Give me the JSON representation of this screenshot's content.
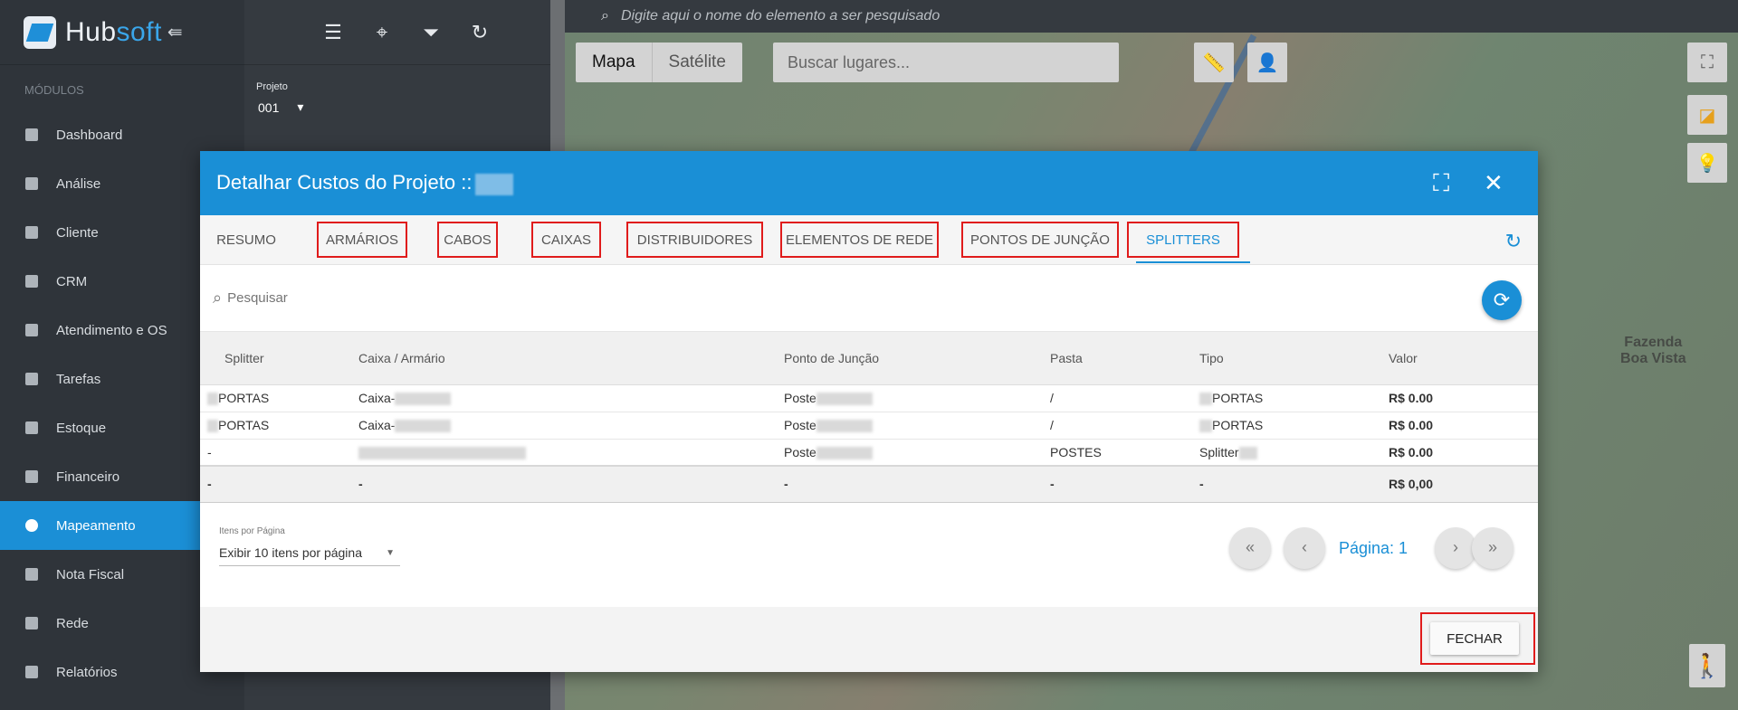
{
  "app": {
    "brand_part1": "Hub",
    "brand_part2": "soft",
    "modules_label": "MÓDULOS"
  },
  "sidebar": {
    "items": [
      {
        "label": "Dashboard",
        "icon": "dashboard-icon"
      },
      {
        "label": "Análise",
        "icon": "pie-chart-icon"
      },
      {
        "label": "Cliente",
        "icon": "contact-card-icon"
      },
      {
        "label": "CRM",
        "icon": "crm-icon"
      },
      {
        "label": "Atendimento e OS",
        "icon": "clock-icon"
      },
      {
        "label": "Tarefas",
        "icon": "calendar-icon"
      },
      {
        "label": "Estoque",
        "icon": "box-icon"
      },
      {
        "label": "Financeiro",
        "icon": "money-icon"
      },
      {
        "label": "Mapeamento",
        "icon": "map-pin-icon",
        "active": true
      },
      {
        "label": "Nota Fiscal",
        "icon": "invoice-icon"
      },
      {
        "label": "Rede",
        "icon": "server-icon"
      },
      {
        "label": "Relatórios",
        "icon": "report-icon"
      }
    ]
  },
  "panel2": {
    "projeto_label": "Projeto",
    "projeto_value": "001"
  },
  "map": {
    "search_placeholder": "Digite aqui o nome do elemento a ser pesquisado",
    "type_map": "Mapa",
    "type_satellite": "Satélite",
    "places_placeholder": "Buscar lugares...",
    "place_label_line1": "Fazenda",
    "place_label_line2": "Boa Vista"
  },
  "modal": {
    "title": "Detalhar Custos do Projeto ::",
    "tabs": [
      "RESUMO",
      "ARMÁRIOS",
      "CABOS",
      "CAIXAS",
      "DISTRIBUIDORES",
      "ELEMENTOS DE REDE",
      "PONTOS DE JUNÇÃO",
      "SPLITTERS"
    ],
    "active_tab": "SPLITTERS",
    "search_placeholder": "Pesquisar",
    "columns": [
      "Splitter",
      "Caixa / Armário",
      "Ponto de Junção",
      "Pasta",
      "Tipo",
      "Valor"
    ],
    "rows": [
      {
        "splitter": "PORTAS",
        "caixa": "Caixa-",
        "ponto": "Poste",
        "pasta": "/",
        "tipo": "PORTAS",
        "valor": "R$ 0.00"
      },
      {
        "splitter": "PORTAS",
        "caixa": "Caixa-",
        "ponto": "Poste",
        "pasta": "/",
        "tipo": "PORTAS",
        "valor": "R$ 0.00"
      },
      {
        "splitter": "-",
        "caixa": "",
        "ponto": "Poste",
        "pasta": "POSTES",
        "tipo": "Splitter",
        "valor": "R$ 0.00"
      }
    ],
    "totals": {
      "splitter": "-",
      "caixa": "-",
      "ponto": "-",
      "pasta": "-",
      "tipo": "-",
      "valor": "R$ 0,00"
    },
    "items_per_page_label": "Itens por Página",
    "items_per_page_value": "Exibir 10 itens por página",
    "page_label": "Página: 1",
    "close_label": "FECHAR"
  },
  "colors": {
    "accent": "#1a8fd6",
    "highlight_box": "#e01b1b"
  }
}
